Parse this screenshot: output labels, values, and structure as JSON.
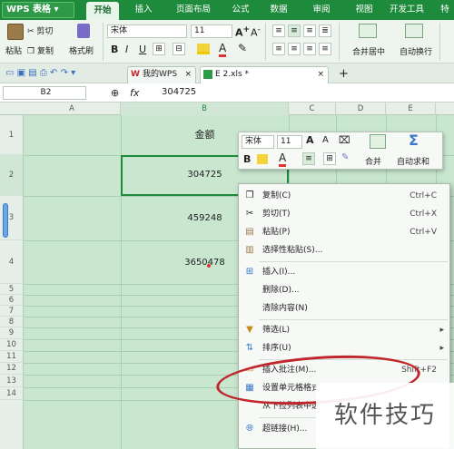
{
  "app": {
    "name": "WPS 表格",
    "dropdown_icon": "caret-down-icon"
  },
  "menu": {
    "tabs": [
      "开始",
      "插入",
      "页面布局",
      "公式",
      "数据",
      "审阅",
      "视图",
      "开发工具",
      "特"
    ],
    "active": "开始"
  },
  "ribbon": {
    "paste": "粘贴",
    "cut": "剪切",
    "copy": "复制",
    "format_painter": "格式刷",
    "font_name": "宋体",
    "font_size": "11",
    "bold": "B",
    "italic": "I",
    "underline": "U",
    "merge": "合并居中",
    "wrap": "自动换行"
  },
  "doc_tabs": [
    {
      "label": "我的WPS"
    },
    {
      "label": "E 2.xls *"
    }
  ],
  "new_tab": "+",
  "formula_bar": {
    "cell_ref": "B2",
    "fx": "fx",
    "value": "304725"
  },
  "columns": [
    "A",
    "B",
    "C",
    "D",
    "E"
  ],
  "rows": [
    "1",
    "2",
    "3",
    "4",
    "5",
    "6",
    "7",
    "8",
    "9",
    "10",
    "11",
    "12",
    "13",
    "14"
  ],
  "cells": {
    "B1": "金额",
    "B2": "304725",
    "B3": "459248",
    "B4": "3650478"
  },
  "mini_toolbar": {
    "font": "宋体",
    "size": "11",
    "grow": "A",
    "shrink": "A",
    "bold": "B",
    "merge": "合并",
    "autosum": "自动求和"
  },
  "context_menu": {
    "items": [
      {
        "label": "复制(C)",
        "shortcut": "Ctrl+C",
        "icon": "copy-icon"
      },
      {
        "label": "剪切(T)",
        "shortcut": "Ctrl+X",
        "icon": "scissors-icon"
      },
      {
        "label": "粘贴(P)",
        "shortcut": "Ctrl+V",
        "icon": "paste-icon"
      },
      {
        "label": "选择性粘贴(S)...",
        "shortcut": "",
        "icon": "paste-special-icon"
      },
      {
        "label": "插入(I)...",
        "shortcut": "",
        "icon": "insert-icon"
      },
      {
        "label": "删除(D)...",
        "shortcut": "",
        "icon": ""
      },
      {
        "label": "清除内容(N)",
        "shortcut": "",
        "icon": ""
      },
      {
        "label": "筛选(L)",
        "shortcut": "",
        "icon": "filter-icon"
      },
      {
        "label": "排序(U)",
        "shortcut": "",
        "icon": "sort-icon"
      },
      {
        "label": "插入批注(M)...",
        "shortcut": "Shift+F2",
        "icon": "comment-icon"
      },
      {
        "label": "设置单元格格式",
        "shortcut": "",
        "icon": "format-cells-icon"
      },
      {
        "label": "从下拉列表中选",
        "shortcut": "",
        "icon": ""
      },
      {
        "label": "超链接(H)...",
        "shortcut": "",
        "icon": "hyperlink-icon"
      }
    ]
  },
  "watermark": "软件技巧",
  "colors": {
    "accent": "#1e8a3c",
    "sheet": "#c9e6cf",
    "highlight_oval": "#c0272d"
  }
}
